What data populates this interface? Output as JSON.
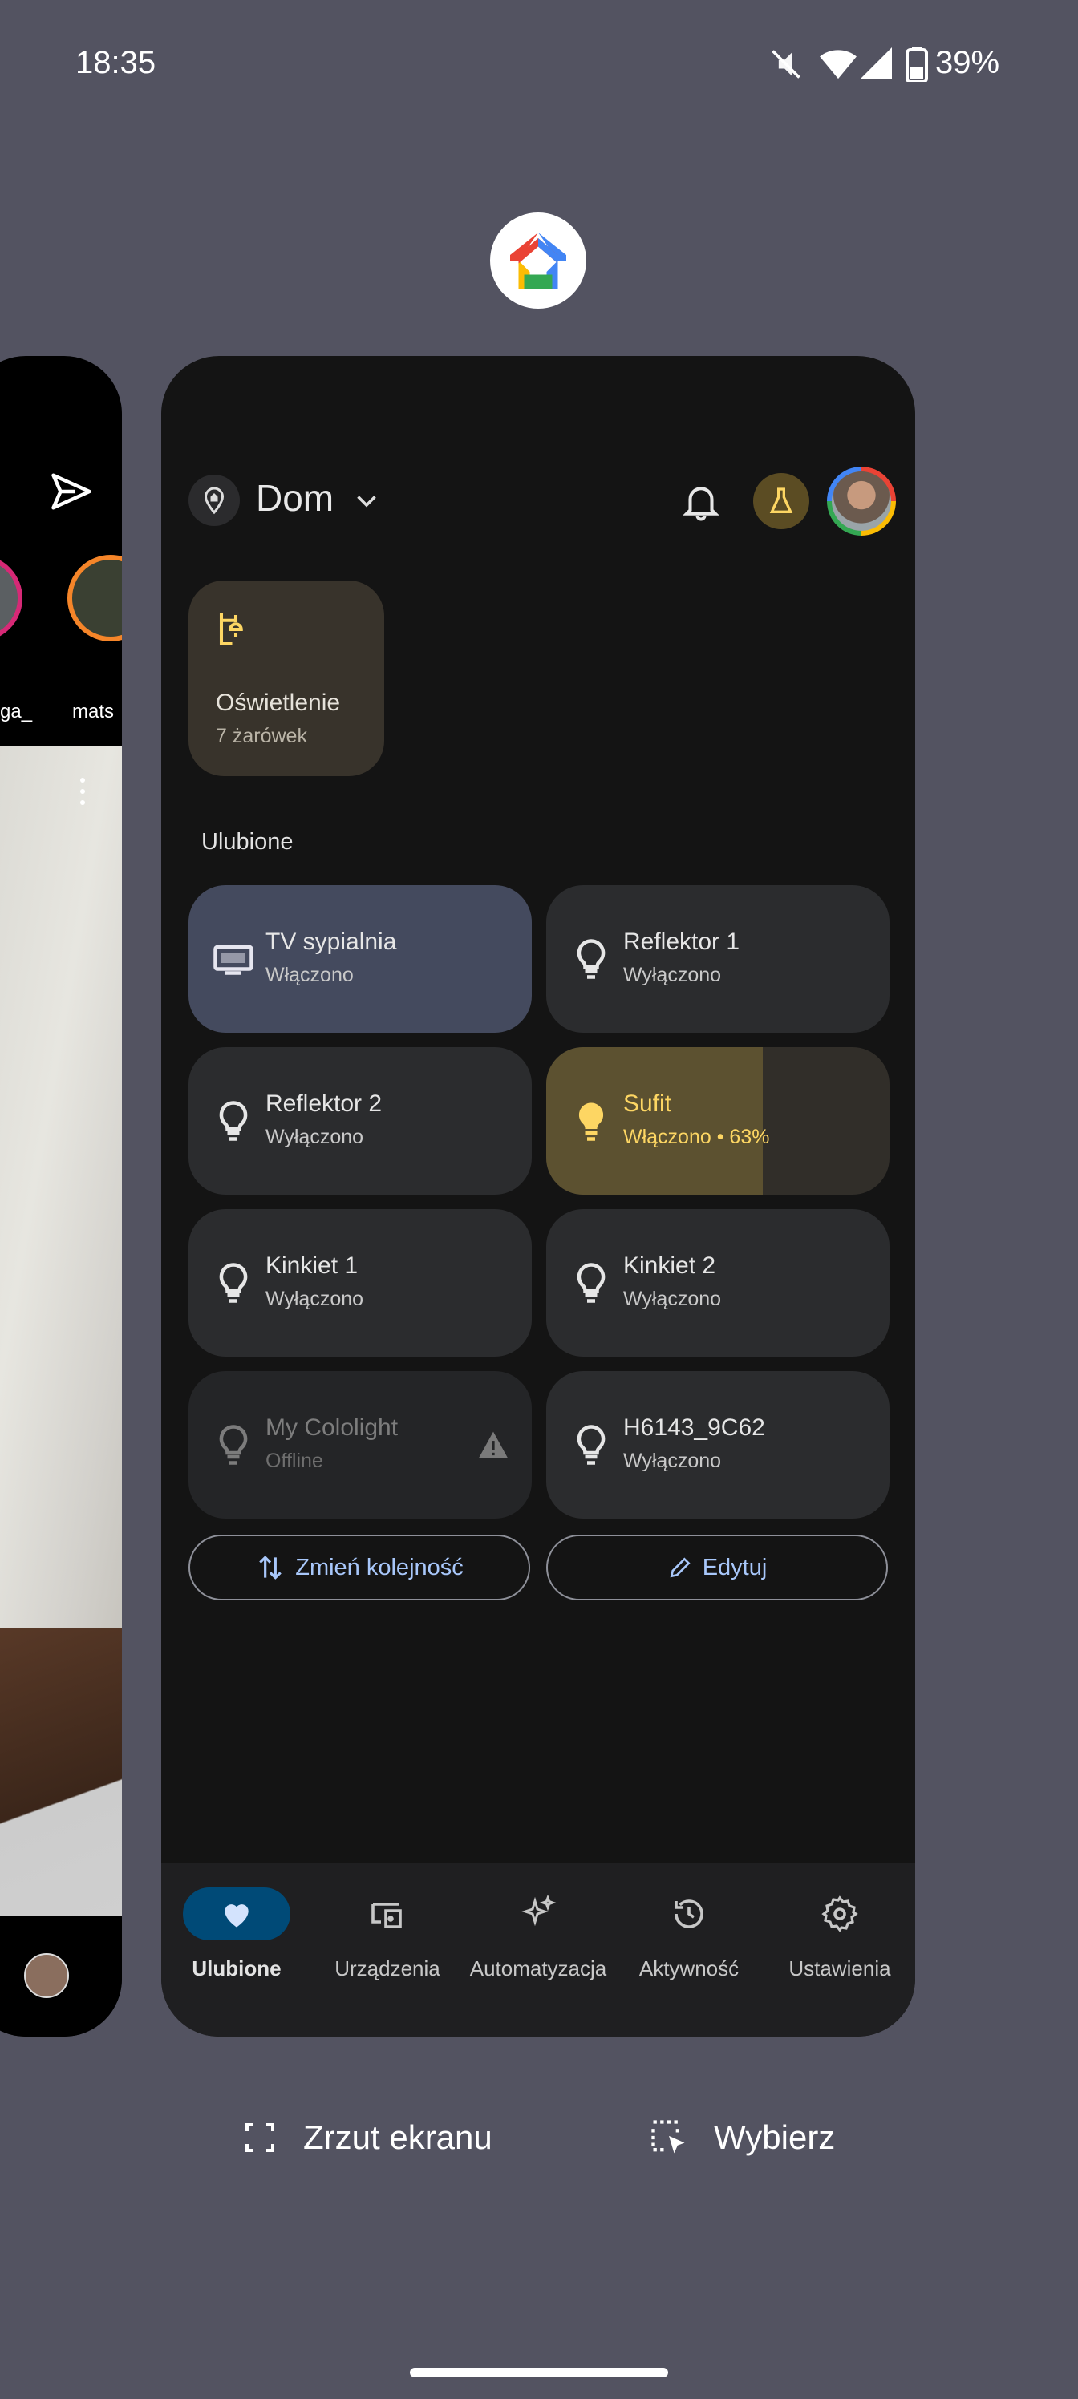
{
  "status_bar": {
    "time": "18:35",
    "battery": "39%",
    "icons": [
      "mute-icon",
      "wifi-icon",
      "signal-icon",
      "battery-icon"
    ]
  },
  "app": {
    "icon": "google-home-icon"
  },
  "left_card": {
    "story_labels": [
      "ga_",
      "mats"
    ]
  },
  "home": {
    "location": "Dom",
    "lighting_tile": {
      "title": "Oświetlenie",
      "subtitle": "7 żarówek"
    },
    "favorites_title": "Ulubione",
    "devices": [
      {
        "name": "TV sypialnia",
        "state": "Włączono",
        "icon": "tv-icon"
      },
      {
        "name": "Reflektor 1",
        "state": "Wyłączono",
        "icon": "bulb-icon"
      },
      {
        "name": "Reflektor 2",
        "state": "Wyłączono",
        "icon": "bulb-icon"
      },
      {
        "name": "Sufit",
        "state": "Włączono • 63%",
        "icon": "bulb-icon",
        "brightness": 0.63
      },
      {
        "name": "Kinkiet 1",
        "state": "Wyłączono",
        "icon": "bulb-icon"
      },
      {
        "name": "Kinkiet 2",
        "state": "Wyłączono",
        "icon": "bulb-icon"
      },
      {
        "name": "My Cololight",
        "state": "Offline",
        "icon": "bulb-icon"
      },
      {
        "name": "H6143_9C62",
        "state": "Wyłączono",
        "icon": "bulb-icon"
      }
    ],
    "reorder_button": "Zmień kolejność",
    "edit_button": "Edytuj",
    "nav": [
      {
        "label": "Ulubione",
        "icon": "heart-icon",
        "active": true
      },
      {
        "label": "Urządzenia",
        "icon": "devices-icon"
      },
      {
        "label": "Automatyzacja",
        "icon": "sparkle-icon"
      },
      {
        "label": "Aktywność",
        "icon": "history-icon"
      },
      {
        "label": "Ustawienia",
        "icon": "gear-icon"
      }
    ]
  },
  "overview": {
    "screenshot_label": "Zrzut ekranu",
    "select_label": "Wybierz"
  },
  "colors": {
    "background": "#535361",
    "card": "#141414",
    "tile": "#2b2c2e",
    "tv_tile": "#444a5e",
    "sufit_tile": "#5c5130",
    "accent_yellow": "#fdd663",
    "accent_blue": "#a8c7fa",
    "nav_active": "#004a77"
  }
}
